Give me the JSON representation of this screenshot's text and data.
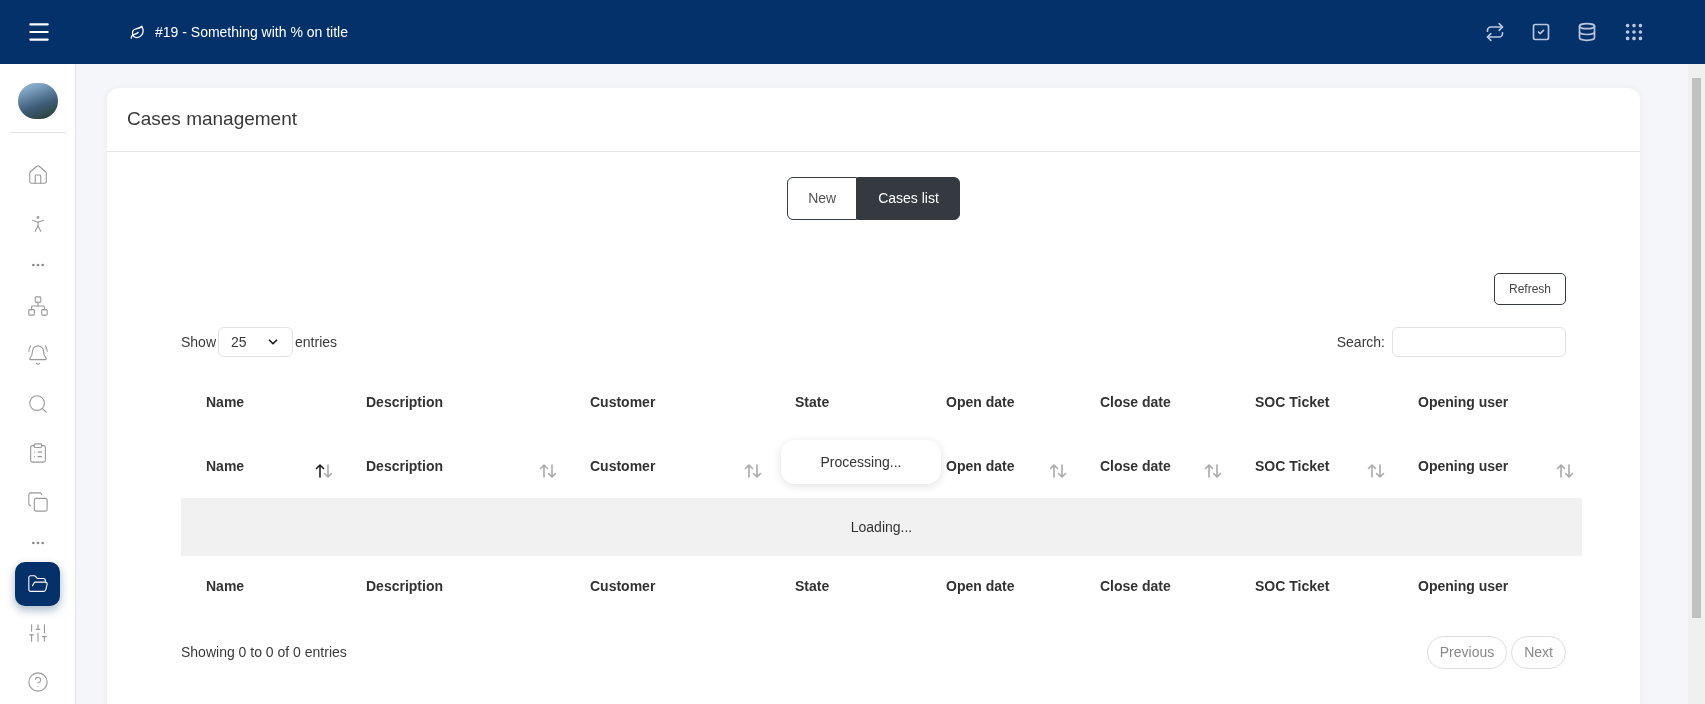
{
  "header": {
    "title": "#19 - Something with % on title"
  },
  "sidebar": {
    "items": [
      {
        "kind": "link",
        "selected": false
      },
      {
        "kind": "link",
        "selected": false
      },
      {
        "kind": "more"
      },
      {
        "kind": "link",
        "selected": false
      },
      {
        "kind": "link",
        "selected": false
      },
      {
        "kind": "link",
        "selected": false
      },
      {
        "kind": "link",
        "selected": false
      },
      {
        "kind": "link",
        "selected": false
      },
      {
        "kind": "more"
      },
      {
        "kind": "link",
        "selected": true
      },
      {
        "kind": "link",
        "selected": false
      },
      {
        "kind": "link",
        "selected": false
      }
    ]
  },
  "card": {
    "title": "Cases management"
  },
  "toggle": [
    {
      "label": "New",
      "selected": false
    },
    {
      "label": "Cases list",
      "selected": true
    }
  ],
  "refresh_button": "Refresh",
  "length": {
    "show": "Show",
    "value": "25",
    "entries": "entries"
  },
  "search": {
    "label": "Search:"
  },
  "table": {
    "header_row": [
      "Name",
      "Description",
      "Customer",
      "State",
      "Open date",
      "Close date",
      "SOC Ticket",
      "Opening user"
    ],
    "sort_row": [
      {
        "label": "Name",
        "sorted_ascending": true
      },
      {
        "label": "Description",
        "sorted_ascending": false
      },
      {
        "label": "Customer",
        "sorted_ascending": false
      },
      {
        "covered": true
      },
      {
        "label": "Open date",
        "sorted_ascending": false
      },
      {
        "label": "Close date",
        "sorted_ascending": false
      },
      {
        "label": "SOC Ticket",
        "sorted_ascending": false
      },
      {
        "label": "Opening user",
        "sorted_ascending": false
      }
    ],
    "loading": "Loading...",
    "footer_row": [
      "Name",
      "Description",
      "Customer",
      "State",
      "Open date",
      "Close date",
      "SOC Ticket",
      "Opening user"
    ]
  },
  "processing": "Processing...",
  "info": "Showing 0 to 0 of 0 entries",
  "pagination": [
    {
      "label": "Previous",
      "disabled": true
    },
    {
      "label": "Next",
      "disabled": true
    }
  ]
}
